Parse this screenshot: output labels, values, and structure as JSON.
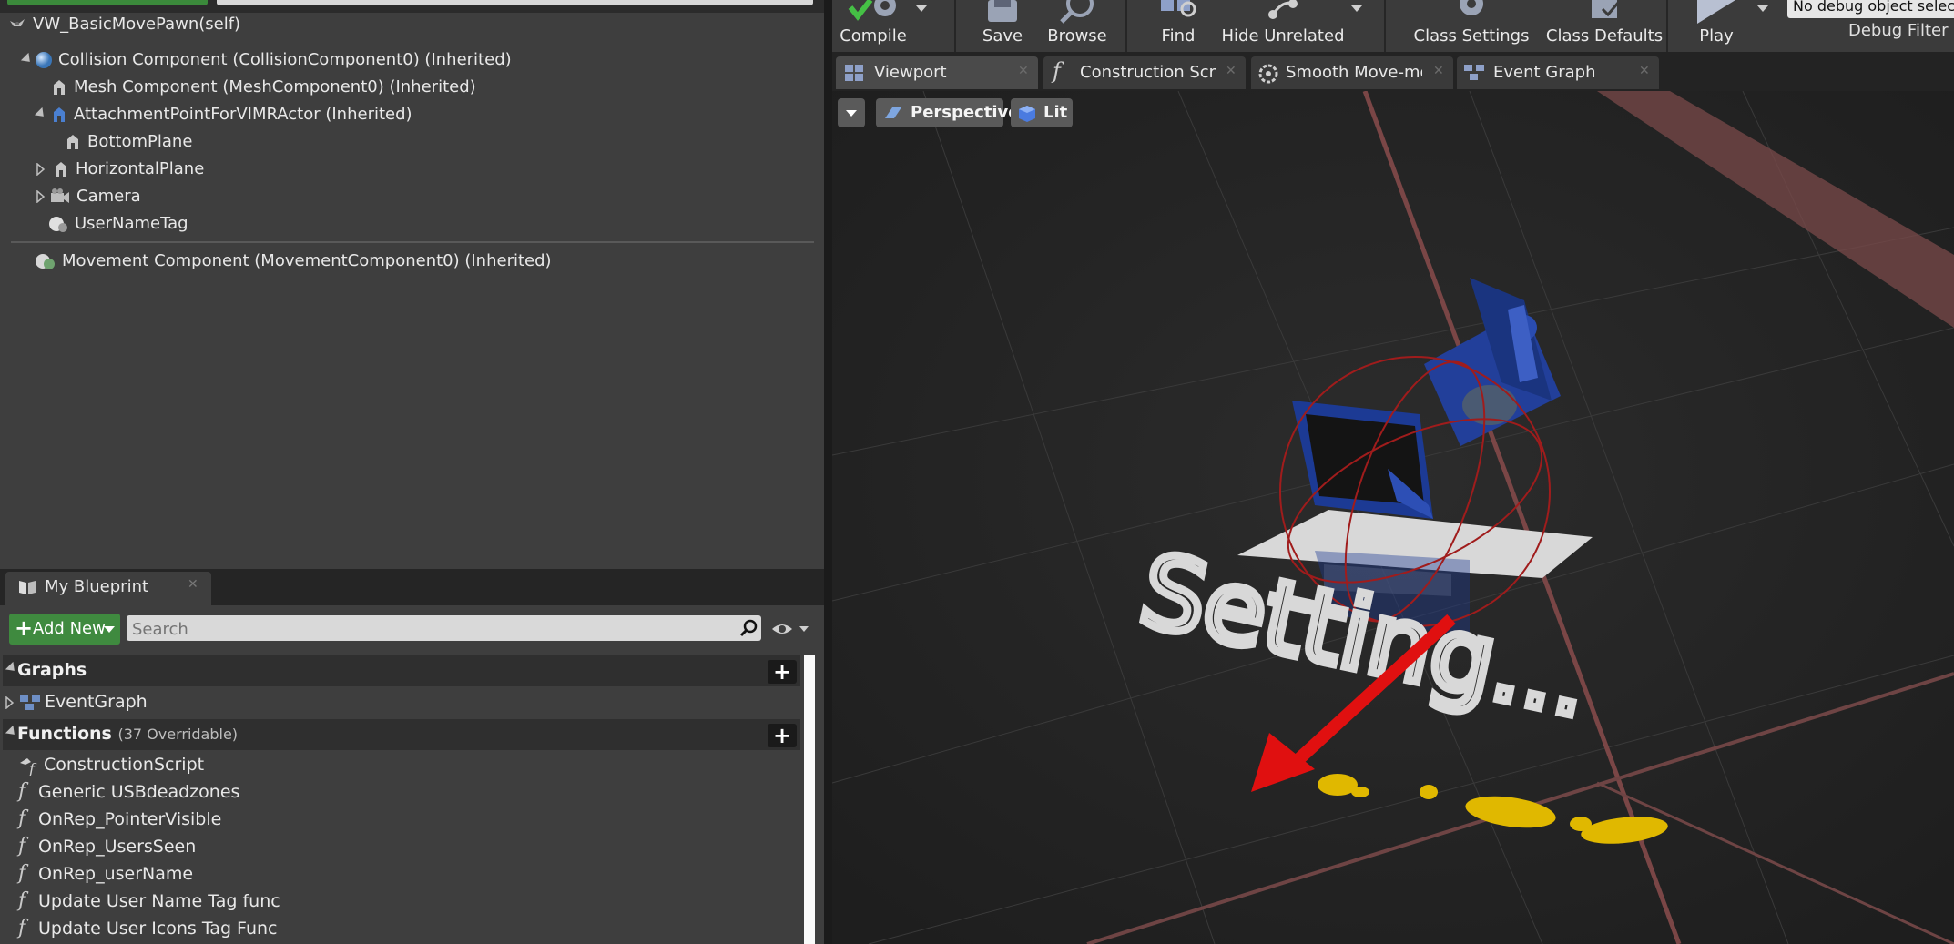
{
  "components": {
    "root": "VW_BasicMovePawn(self)",
    "items": [
      {
        "label": "Collision Component (CollisionComponent0) (Inherited)"
      },
      {
        "label": "Mesh Component (MeshComponent0) (Inherited)"
      },
      {
        "label": "AttachmentPointForVIMRActor (Inherited)"
      },
      {
        "label": "BottomPlane"
      },
      {
        "label": "HorizontalPlane"
      },
      {
        "label": "Camera"
      },
      {
        "label": "UserNameTag"
      },
      {
        "label": "Movement Component (MovementComponent0) (Inherited)"
      }
    ]
  },
  "my_blueprint": {
    "tab_label": "My Blueprint",
    "add_new_label": "Add New",
    "search_placeholder": "Search",
    "graphs": {
      "title": "Graphs",
      "items": [
        "EventGraph"
      ]
    },
    "functions": {
      "title": "Functions",
      "subtitle": "(37 Overridable)",
      "items": [
        "ConstructionScript",
        "Generic USBdeadzones",
        "OnRep_PointerVisible",
        "OnRep_UsersSeen",
        "OnRep_userName",
        "Update User Name Tag func",
        "Update User Icons Tag Func"
      ]
    }
  },
  "toolbar": {
    "compile": "Compile",
    "save": "Save",
    "browse": "Browse",
    "find": "Find",
    "hide_unrelated": "Hide Unrelated",
    "class_settings": "Class Settings",
    "class_defaults": "Class Defaults",
    "play": "Play",
    "debug_object": "No debug object selected",
    "debug_filter": "Debug Filter"
  },
  "tabs": [
    "Viewport",
    "Construction Script",
    "Smooth Move-mode",
    "Event Graph"
  ],
  "viewport": {
    "view_mode": "Perspective",
    "lighting": "Lit",
    "scene_text": "Setting..."
  },
  "colors": {
    "accent_green": "#3f8a3f",
    "gizmo_red": "#e01010",
    "mesh_blue": "#1f3f9e"
  }
}
